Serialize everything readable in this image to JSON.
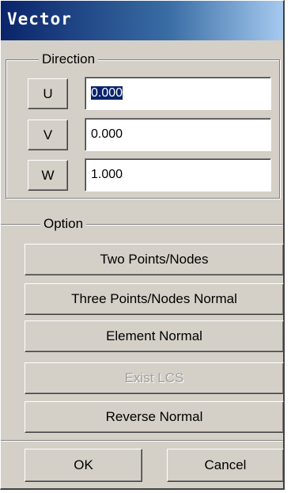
{
  "window": {
    "title": "Vector"
  },
  "direction": {
    "label": "Direction",
    "rows": [
      {
        "axis": "U",
        "value": "0.000",
        "selected": true
      },
      {
        "axis": "V",
        "value": "0.000",
        "selected": false
      },
      {
        "axis": "W",
        "value": "1.000",
        "selected": false
      }
    ]
  },
  "option": {
    "label": "Option",
    "buttons": [
      {
        "label": "Two Points/Nodes",
        "enabled": true
      },
      {
        "label": "Three Points/Nodes Normal",
        "enabled": true
      },
      {
        "label": "Element Normal",
        "enabled": true
      },
      {
        "label": "Exist LCS",
        "enabled": false
      },
      {
        "label": "Reverse Normal",
        "enabled": true
      }
    ]
  },
  "footer": {
    "ok_label": "OK",
    "cancel_label": "Cancel"
  }
}
